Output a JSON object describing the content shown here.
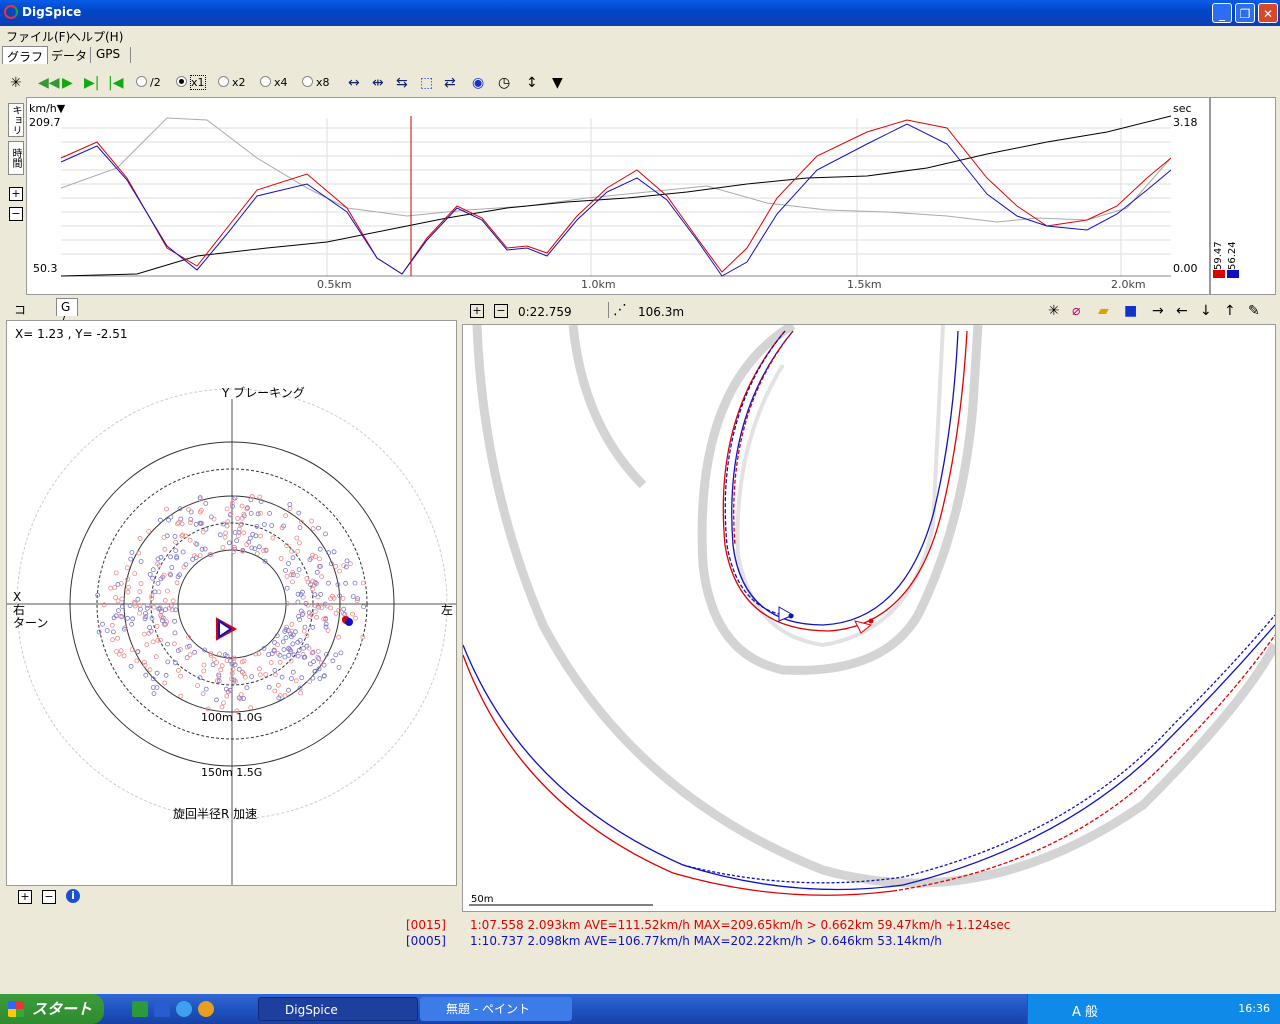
{
  "window": {
    "title": "DigSpice"
  },
  "menu": [
    "ファイル(F)",
    "ヘルプ(H)"
  ],
  "top_tabs": [
    "グラフ",
    "データ",
    "GPS"
  ],
  "toolbar": {
    "rate_options": [
      "/2",
      "x1",
      "x2",
      "x4",
      "x8"
    ],
    "selected_rate": "x1"
  },
  "graph": {
    "side_tabs": [
      "キョリ",
      "時間"
    ],
    "left_unit": "km/h▼",
    "left_max": "209.7",
    "left_min": "50.3",
    "right_unit": "sec",
    "right_max": "3.18",
    "right_min": "0.00",
    "x_ticks": [
      "0.5km",
      "1.0km",
      "1.5km",
      "2.0km"
    ],
    "legend_values": [
      "59.47",
      "56.24"
    ]
  },
  "left_panel": {
    "tabs": [
      "コース",
      "G / 旋回半径"
    ],
    "xy_readout": "X=  1.23 , Y= -2.51",
    "labels": {
      "top": "Y ブレーキング",
      "left_x": "X",
      "left_turn1": "右",
      "left_turn2": "ターン",
      "right": "左",
      "ring1": "100m 1.0G",
      "ring2": "150m 1.5G",
      "bottom": "旋回半径R 加速"
    }
  },
  "map": {
    "time": "0:22.759",
    "distance": "106.3m",
    "scale_label": "50m"
  },
  "status": {
    "line1_id": "[0015]",
    "line1": "1:07.558 2.093km AVE=111.52km/h MAX=209.65km/h > 0.662km 59.47km/h +1.124sec",
    "line2_id": "[0005]",
    "line2": "1:10.737 2.098km AVE=106.77km/h MAX=202.22km/h > 0.646km 53.14km/h"
  },
  "taskbar": {
    "start": "スタート",
    "tasks": [
      "DigSpice",
      "無題 - ペイント"
    ],
    "ime": "A 般",
    "clock": "16:36"
  },
  "colors": {
    "lap_red": "#e00000",
    "lap_blue": "#1010c0",
    "titlebar": "#0a5ce8"
  }
}
